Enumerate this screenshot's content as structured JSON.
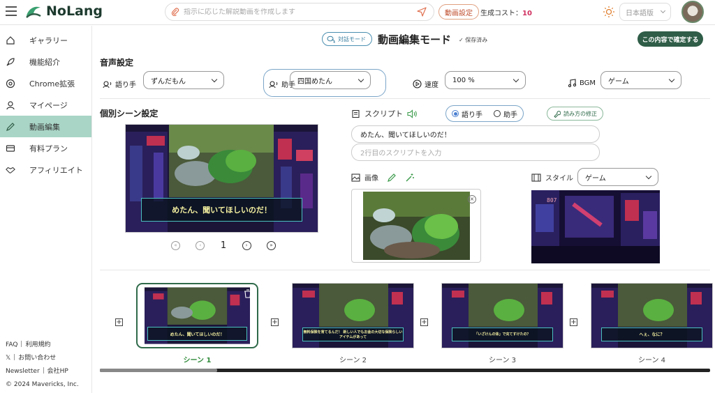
{
  "header": {
    "logo_text": "NoLang",
    "prompt_placeholder": "指示に応じた解説動画を作成します",
    "settings_label": "動画設定",
    "cost_label": "生成コスト：",
    "cost_value": "10",
    "language": "日本語版"
  },
  "sidebar": {
    "items": [
      {
        "label": "ギャラリー",
        "icon": "home-icon"
      },
      {
        "label": "機能紹介",
        "icon": "rocket-icon"
      },
      {
        "label": "Chrome拡張",
        "icon": "chrome-icon"
      },
      {
        "label": "マイページ",
        "icon": "user-icon"
      },
      {
        "label": "動画編集",
        "icon": "pencil-icon"
      },
      {
        "label": "有料プラン",
        "icon": "card-icon"
      },
      {
        "label": "アフィリエイト",
        "icon": "handshake-icon"
      }
    ],
    "footer": {
      "faq": "FAQ",
      "terms": "利用規約",
      "x": "𝕏",
      "contact": "お問い合わせ",
      "newsletter": "Newsletter",
      "company": "会社HP",
      "copyright": "© 2024 Mavericks, Inc."
    }
  },
  "title_bar": {
    "mode_chip": "対話モード",
    "title": "動画編集モード",
    "saved": "✓ 保存済み",
    "confirm": "この内容で確定する"
  },
  "voice": {
    "heading": "音声設定",
    "narrator_label": "語り手",
    "narrator_value": "ずんだもん",
    "helper_label": "助手",
    "helper_value": "四国めたん",
    "speed_label": "速度",
    "speed_value": "100 %",
    "bgm_label": "BGM",
    "bgm_value": "ゲーム"
  },
  "scene": {
    "heading": "個別シーン設定",
    "caption": "めたん、聞いてほしいのだ！",
    "page": "1",
    "script_label": "スクリプト",
    "role_narrator": "語り手",
    "role_helper": "助手",
    "fix_reading": "読み方の修正",
    "script_line1": "めたん、聞いてほしいのだ！",
    "script_line2_placeholder": "2行目のスクリプトを入力",
    "image_label": "画像",
    "style_label": "スタイル",
    "style_value": "ゲーム",
    "style_sign": "807"
  },
  "thumbnails": [
    {
      "label": "シーン 1",
      "caption": "めたん、聞いてほしいのだ！",
      "selected": true
    },
    {
      "label": "シーン 2",
      "caption": "無料保険を育てるんだ！ 新しい人でもお金の大切な保険らしいアイテムがあって",
      "selected": false
    },
    {
      "label": "シーン 3",
      "caption": "「いざけんの体」で充てすけたの？",
      "selected": false
    },
    {
      "label": "シーン 4",
      "caption": "へぇ、なに？",
      "selected": false
    }
  ],
  "colors": {
    "accent_green": "#2f5d47",
    "active_nav": "#a9d5c6",
    "cost": "#d03060"
  }
}
